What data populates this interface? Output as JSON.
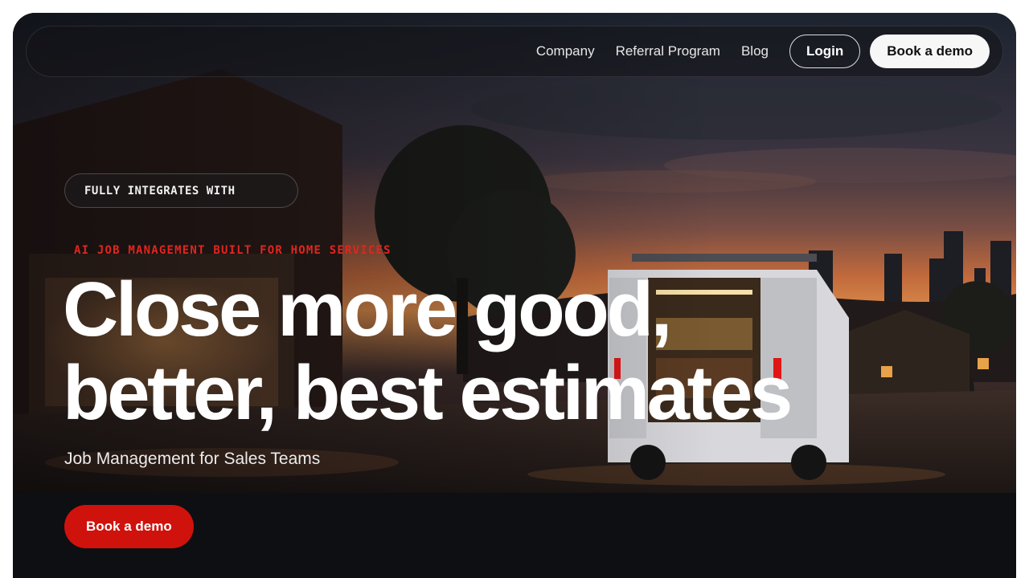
{
  "nav": {
    "links": [
      "Company",
      "Referral Program",
      "Blog"
    ],
    "login_label": "Login",
    "demo_label": "Book a demo"
  },
  "hero": {
    "integrations_pill": "FULLY INTEGRATES WITH",
    "eyebrow": "AI JOB MANAGEMENT BUILT FOR HOME SERVICES",
    "headline_line1": "Close more good,",
    "headline_line2": "better, best estimates",
    "subheadline": "Job Management for Sales Teams",
    "cta_label": "Book a demo"
  },
  "colors": {
    "accent_red": "#d0120c",
    "eyebrow_red": "#e0261f",
    "dark_background": "#0d0f12",
    "text_light": "#ffffff"
  },
  "icons": {
    "background": "service-van-at-dusk-photo"
  }
}
